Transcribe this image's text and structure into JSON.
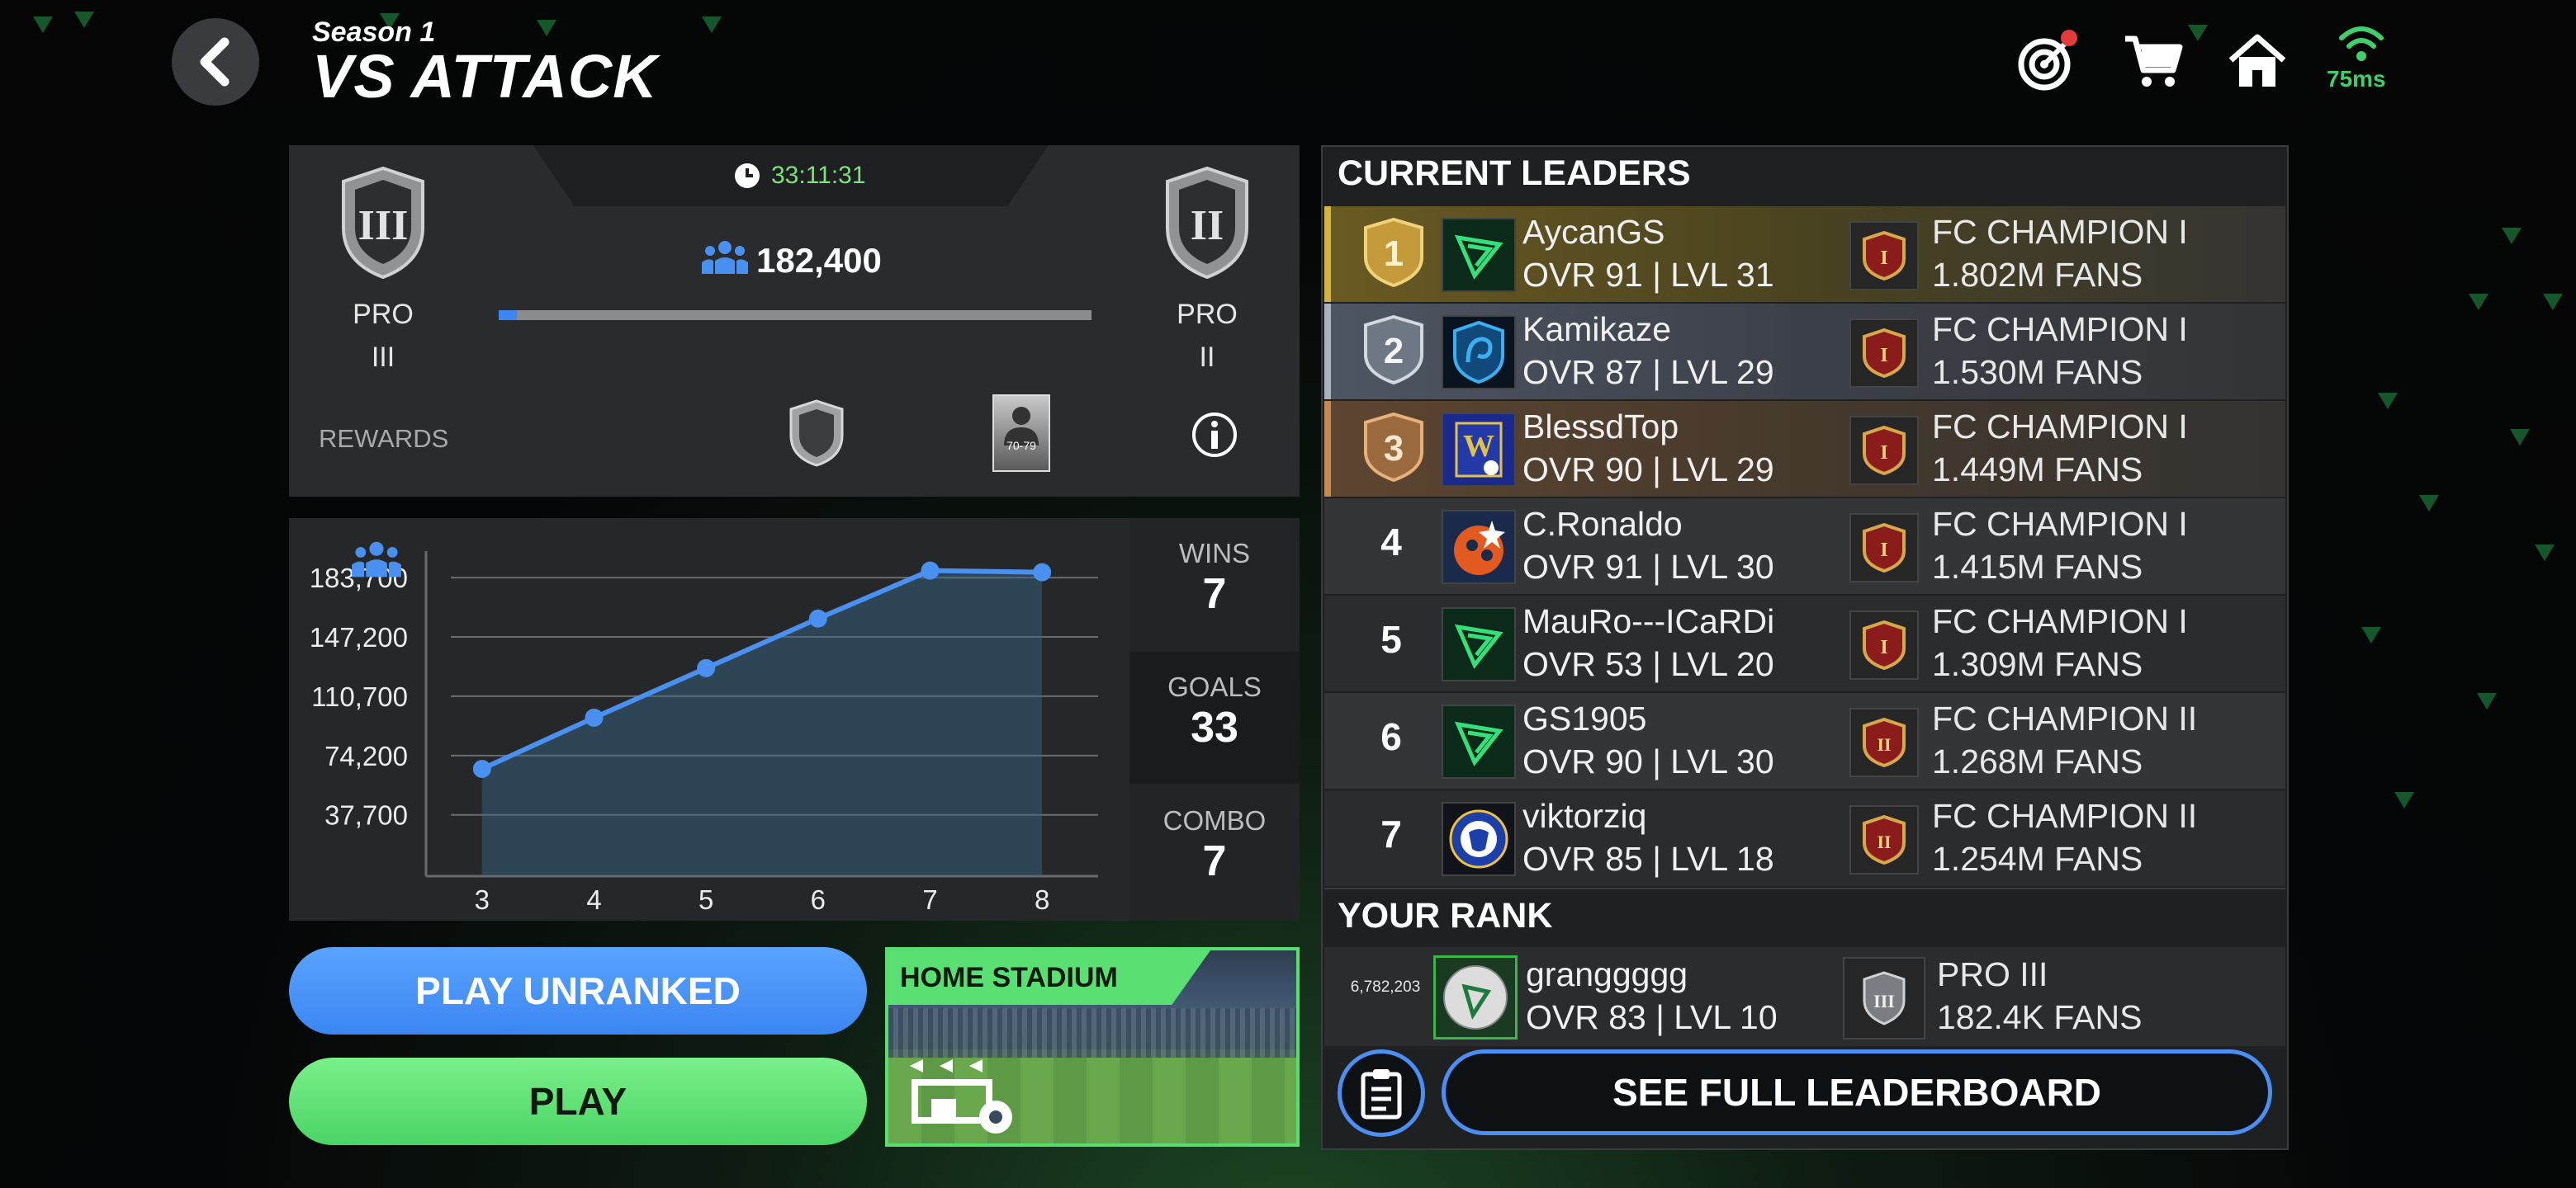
{
  "header": {
    "season": "Season 1",
    "title": "VS ATTACK",
    "ping": "75ms"
  },
  "season_panel": {
    "timer": "33:11:31",
    "points": "182,400",
    "progress_fraction": 0.03,
    "current_rank": {
      "tier": "PRO",
      "level": "III"
    },
    "next_rank": {
      "tier": "PRO",
      "level": "II"
    },
    "rewards_label": "REWARDS",
    "reward_pack_label": "70-79"
  },
  "stats": {
    "wins_label": "WINS",
    "wins": "7",
    "goals_label": "GOALS",
    "goals": "33",
    "combo_label": "COMBO",
    "combo": "7"
  },
  "chart_data": {
    "type": "area",
    "x": [
      3,
      4,
      5,
      6,
      7,
      8
    ],
    "y": [
      66000,
      97500,
      128000,
      158500,
      188000,
      187000
    ],
    "yticks": [
      "37,700",
      "74,200",
      "110,700",
      "147,200",
      "183,700"
    ],
    "ytick_values": [
      37700,
      74200,
      110700,
      147200,
      183700
    ],
    "xticks": [
      "3",
      "4",
      "5",
      "6",
      "7",
      "8"
    ],
    "ylim": [
      0,
      200000
    ],
    "grid": true,
    "color": "#4a90f0"
  },
  "buttons": {
    "play_unranked": "PLAY UNRANKED",
    "play": "PLAY",
    "home_stadium": "HOME STADIUM",
    "see_full_leaderboard": "SEE FULL LEADERBOARD"
  },
  "leaders": {
    "title": "CURRENT LEADERS",
    "rows": [
      {
        "pos": "1",
        "name": "AycanGS",
        "stats": "OVR 91 | LVL 31",
        "division": "FC CHAMPION I",
        "fans": "1.802M FANS"
      },
      {
        "pos": "2",
        "name": "Kamikaze",
        "stats": "OVR 87 | LVL 29",
        "division": "FC CHAMPION I",
        "fans": "1.530M FANS"
      },
      {
        "pos": "3",
        "name": "BlessdTop",
        "stats": "OVR 90 | LVL 29",
        "division": "FC CHAMPION I",
        "fans": "1.449M FANS"
      },
      {
        "pos": "4",
        "name": "C.Ronaldo",
        "stats": "OVR 91 | LVL 30",
        "division": "FC CHAMPION I",
        "fans": "1.415M FANS"
      },
      {
        "pos": "5",
        "name": "MauRo---ICaRDi",
        "stats": "OVR 53 | LVL 20",
        "division": "FC CHAMPION I",
        "fans": "1.309M FANS"
      },
      {
        "pos": "6",
        "name": "GS1905",
        "stats": "OVR 90 | LVL 30",
        "division": "FC CHAMPION II",
        "fans": "1.268M FANS"
      },
      {
        "pos": "7",
        "name": "viktorziq",
        "stats": "OVR 85 | LVL 18",
        "division": "FC CHAMPION II",
        "fans": "1.254M FANS"
      }
    ]
  },
  "your_rank": {
    "title": "YOUR RANK",
    "rank_number": "6,782,203",
    "name": "granggggg",
    "stats": "OVR 83 | LVL 10",
    "division": "PRO III",
    "fans": "182.4K FANS"
  },
  "colors": {
    "accent_blue": "#4b8ff5",
    "accent_green": "#4bd365",
    "gold": "#b89a3a",
    "silver": "#7c8592",
    "bronze": "#a8774a"
  }
}
